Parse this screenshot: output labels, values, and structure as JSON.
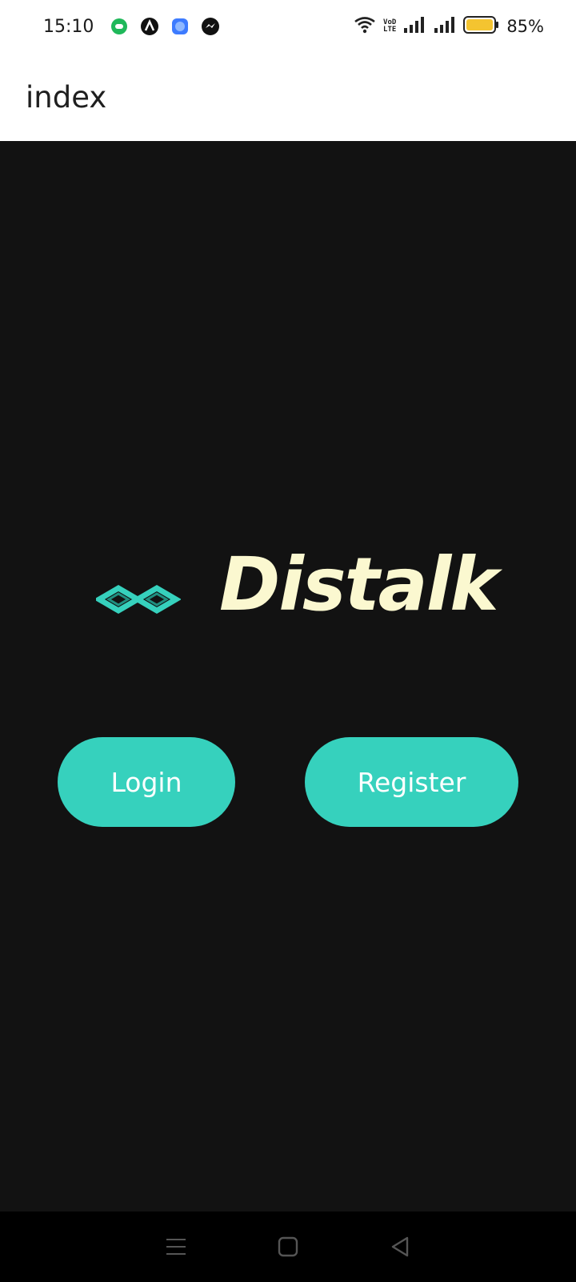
{
  "status_bar": {
    "time": "15:10",
    "notification_icons": [
      "chat-bubble-icon",
      "app-a-icon",
      "blue-app-icon",
      "messenger-icon"
    ],
    "volte_top": "VoD",
    "volte_bottom": "LTE",
    "battery_percent": "85%",
    "battery_color": "#f4c430"
  },
  "app_bar": {
    "title": "index"
  },
  "main": {
    "brand_name": "Distalk",
    "brand_color": "#fbf8d0",
    "logo_color": "#36d1bd",
    "login_label": "Login",
    "register_label": "Register",
    "button_color": "#36d1bd"
  },
  "nav_bar": {
    "items": [
      "menu-icon",
      "home-icon",
      "back-icon"
    ]
  }
}
